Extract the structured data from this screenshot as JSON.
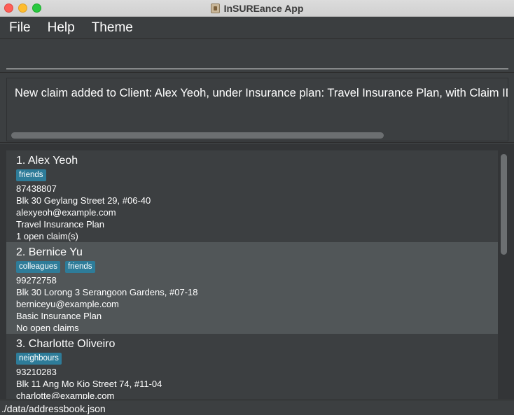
{
  "window": {
    "title": "InSUREance App",
    "app_icon": "insureance-app-icon"
  },
  "menu": {
    "items": [
      "File",
      "Help",
      "Theme"
    ]
  },
  "command": {
    "value": "",
    "placeholder": ""
  },
  "result": {
    "message": "New claim added to Client: Alex Yeoh, under Insurance plan: Travel Insurance Plan, with Claim ID: B"
  },
  "clients": [
    {
      "index_name": "1. Alex Yeoh",
      "tags": [
        "friends"
      ],
      "phone": "87438807",
      "address": "Blk 30 Geylang Street 29, #06-40",
      "email": "alexyeoh@example.com",
      "plan": "Travel Insurance Plan",
      "claims": "1 open claim(s)"
    },
    {
      "index_name": "2. Bernice Yu",
      "tags": [
        "colleagues",
        "friends"
      ],
      "phone": "99272758",
      "address": "Blk 30 Lorong 3 Serangoon Gardens, #07-18",
      "email": "berniceyu@example.com",
      "plan": "Basic Insurance Plan",
      "claims": "No open claims"
    },
    {
      "index_name": "3. Charlotte Oliveiro",
      "tags": [
        "neighbours"
      ],
      "phone": "93210283",
      "address": "Blk 11 Ang Mo Kio Street 74, #11-04",
      "email": "charlotte@example.com",
      "plan": "",
      "claims": ""
    }
  ],
  "status": {
    "file_path": "./data/addressbook.json"
  },
  "colors": {
    "tag": "#2e7c99",
    "background": "#3c3f41",
    "selected_card": "#515658",
    "close": "#fe5f57",
    "minimize": "#febc2e",
    "maximize": "#28c840"
  }
}
